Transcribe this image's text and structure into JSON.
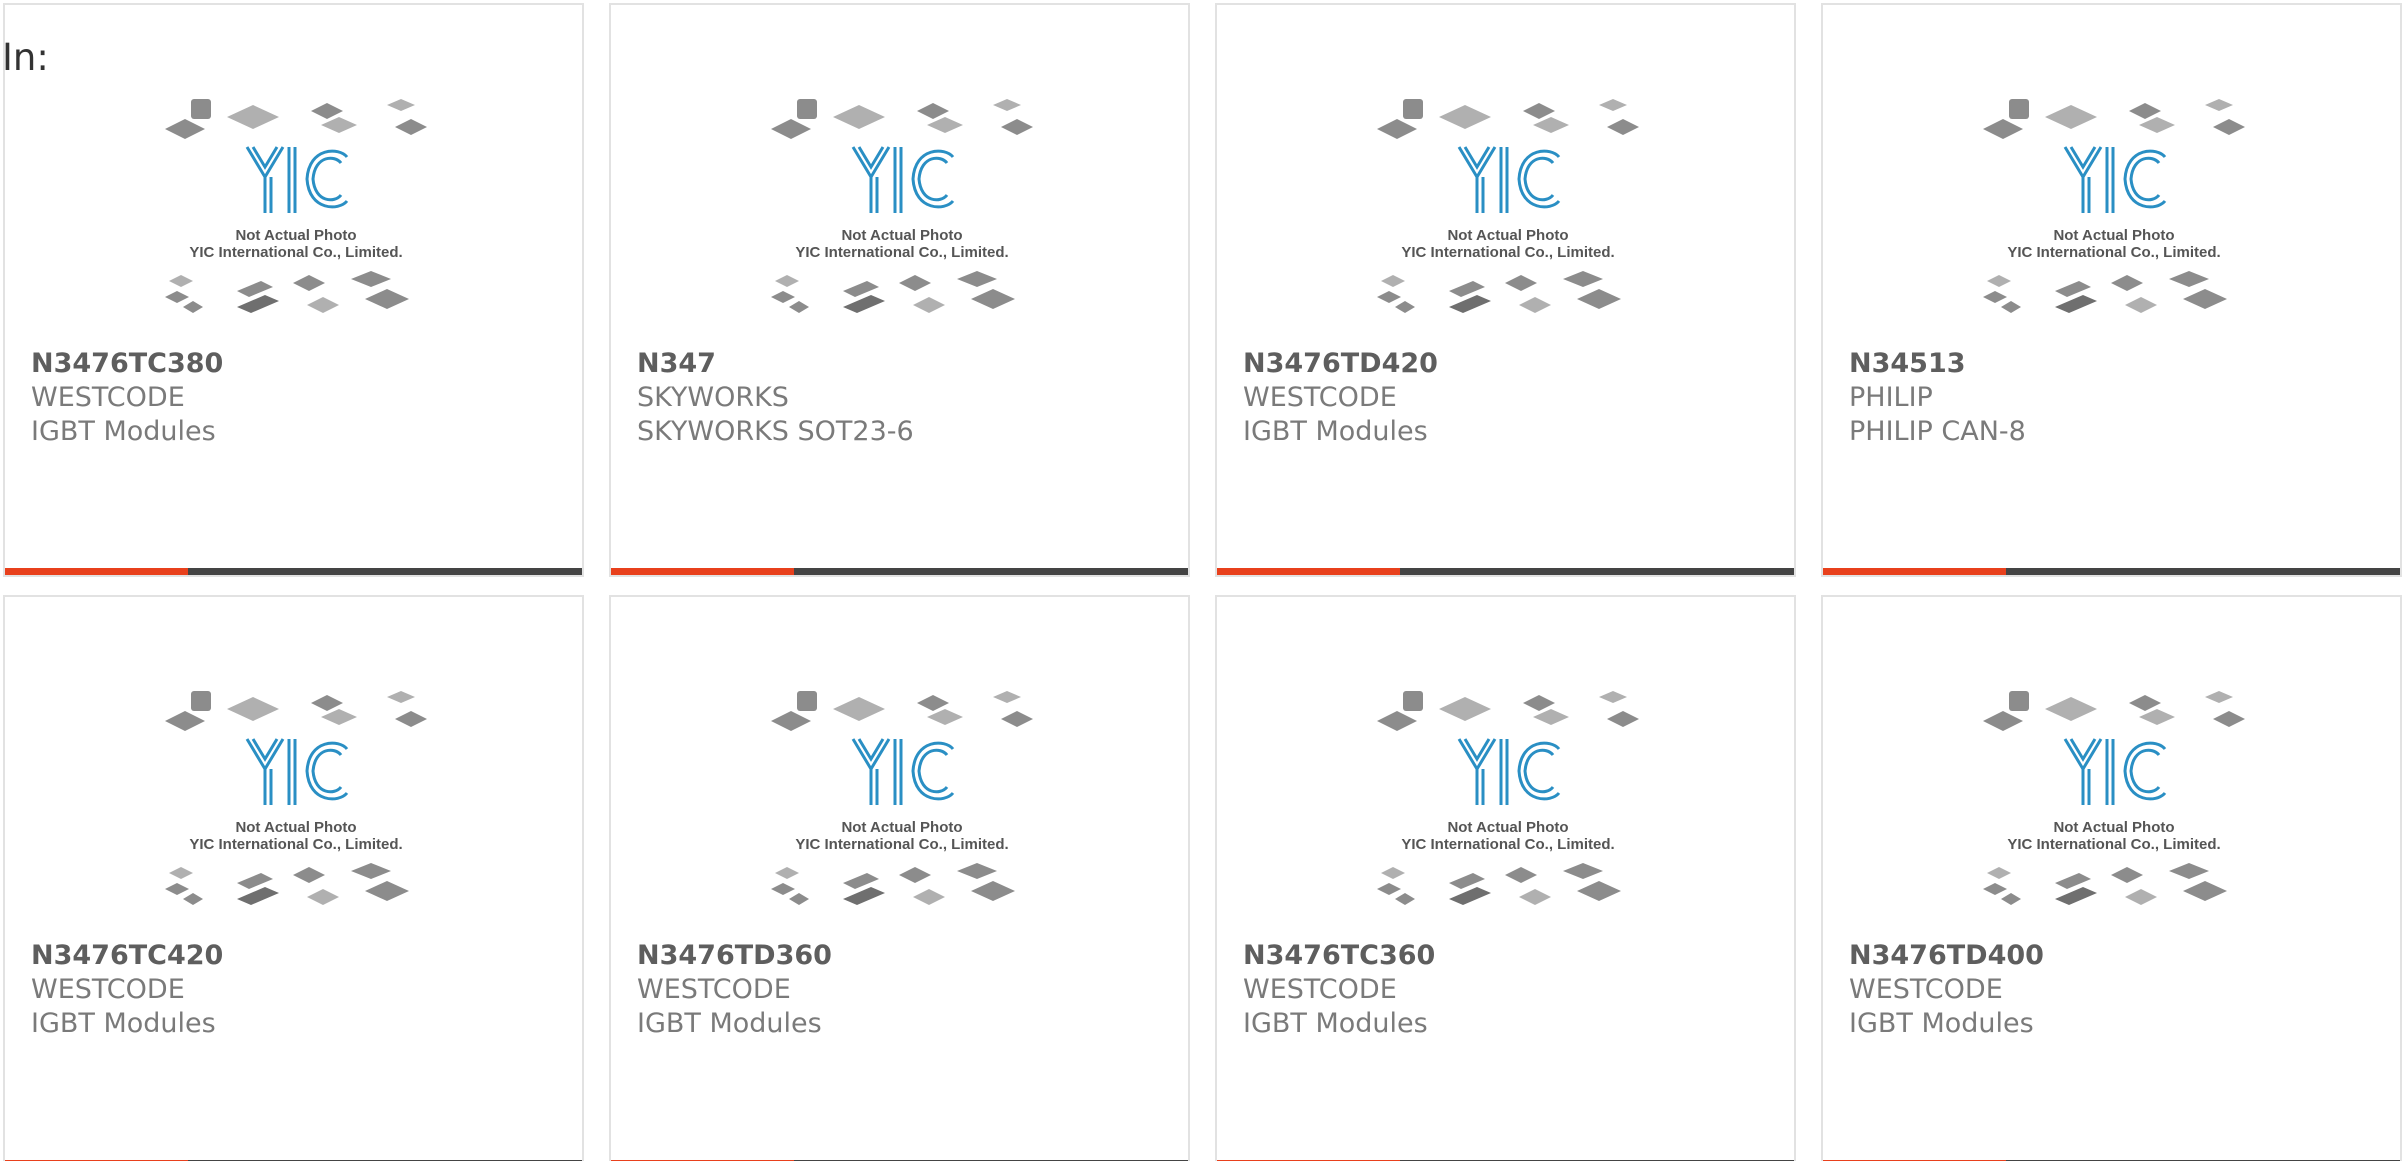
{
  "header": {
    "label": "In:"
  },
  "image": {
    "caption_line1": "Not Actual Photo",
    "caption_line2": "YIC International Co., Limited.",
    "logo_text": "YIC",
    "logo_color": "#2a8fc4"
  },
  "colors": {
    "accent": "#e8401c",
    "bar": "#444444",
    "border": "#e2e2e2"
  },
  "products": [
    {
      "part_number": "N3476TC380",
      "manufacturer": "WESTCODE",
      "category": "IGBT Modules"
    },
    {
      "part_number": "N347",
      "manufacturer": "SKYWORKS",
      "category": "SKYWORKS SOT23-6"
    },
    {
      "part_number": "N3476TD420",
      "manufacturer": "WESTCODE",
      "category": "IGBT Modules"
    },
    {
      "part_number": "N34513",
      "manufacturer": "PHILIP",
      "category": "PHILIP CAN-8"
    },
    {
      "part_number": "N3476TC420",
      "manufacturer": "WESTCODE",
      "category": "IGBT Modules"
    },
    {
      "part_number": "N3476TD360",
      "manufacturer": "WESTCODE",
      "category": "IGBT Modules"
    },
    {
      "part_number": "N3476TC360",
      "manufacturer": "WESTCODE",
      "category": "IGBT Modules"
    },
    {
      "part_number": "N3476TD400",
      "manufacturer": "WESTCODE",
      "category": "IGBT Modules"
    }
  ]
}
